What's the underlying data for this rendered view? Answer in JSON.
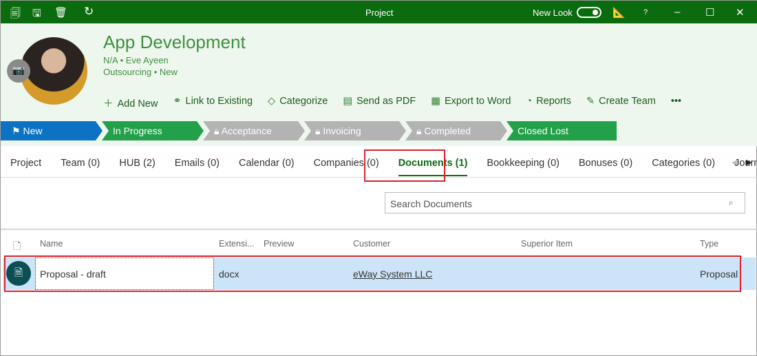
{
  "titlebar": {
    "title": "Project",
    "new_look_label": "New Look",
    "help": "?",
    "new_look_on": true
  },
  "record": {
    "title": "App Development",
    "line1": "N/A • Eve Ayeen",
    "line2": "Outsourcing • New"
  },
  "actions": [
    {
      "icon": "plus-icon",
      "label": "Add New"
    },
    {
      "icon": "link-icon",
      "label": "Link to Existing"
    },
    {
      "icon": "tag-icon",
      "label": "Categorize"
    },
    {
      "icon": "pdf-icon",
      "label": "Send as PDF"
    },
    {
      "icon": "word-icon",
      "label": "Export to Word"
    },
    {
      "icon": "chart-pie-icon",
      "label": "Reports"
    },
    {
      "icon": "team-icon",
      "label": "Create Team"
    }
  ],
  "more": "•••",
  "stages": [
    {
      "label": "New",
      "color": "#0b72c4",
      "icon": "flag"
    },
    {
      "label": "In Progress",
      "color": "#23a04a"
    },
    {
      "label": "Acceptance",
      "color": "#b3b3b3",
      "icon": "lock"
    },
    {
      "label": "Invoicing",
      "color": "#b3b3b3",
      "icon": "lock"
    },
    {
      "label": "Completed",
      "color": "#b3b3b3",
      "icon": "lock"
    },
    {
      "label": "Closed Lost",
      "color": "#23a04a"
    }
  ],
  "tabs": [
    "Project",
    "Team (0)",
    "HUB (2)",
    "Emails (0)",
    "Calendar (0)",
    "Companies (0)",
    "Documents (1)",
    "Bookkeeping (0)",
    "Bonuses (0)",
    "Categories (0)",
    "Journal"
  ],
  "search": {
    "placeholder": "Search Documents"
  },
  "columns": [
    "Name",
    "Extensi...",
    "Preview",
    "Customer",
    "Superior Item",
    "Type"
  ],
  "rows": [
    {
      "name": "Proposal - draft",
      "extension": "docx",
      "preview": "",
      "customer": "eWay System LLC",
      "superior": "",
      "type": "Proposal"
    }
  ]
}
